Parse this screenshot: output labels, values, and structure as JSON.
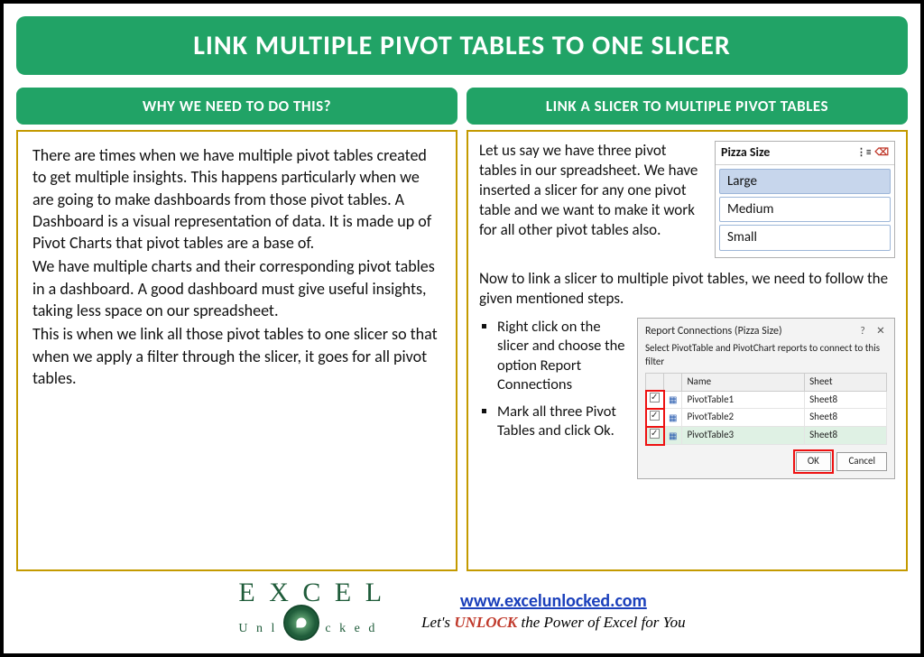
{
  "title": "LINK MULTIPLE PIVOT TABLES TO ONE SLICER",
  "left": {
    "header": "WHY WE NEED TO DO THIS?",
    "p1": "There are times when we have multiple pivot tables created to get multiple insights. This happens particularly when we are going to make dashboards from those pivot tables. A Dashboard is a visual representation of data. It is made up of Pivot Charts that pivot tables are a base of.",
    "p2": "We have multiple charts and their corresponding pivot tables in a dashboard. A good dashboard must give useful insights, taking less space on our spreadsheet.",
    "p3": "This is when we link all those pivot tables to one slicer so that when we apply a filter through the slicer, it goes for all pivot tables."
  },
  "right": {
    "header": "LINK A SLICER TO MULTIPLE PIVOT TABLES",
    "intro": "Let us say we have three pivot tables in our spreadsheet. We have inserted a slicer for any one pivot table and we want to make it work for all other pivot tables also.",
    "mid": "Now to link a slicer to multiple pivot tables, we need to follow the given mentioned steps.",
    "step1": "Right click on the slicer and choose the option Report Connections",
    "step2": "Mark all three Pivot Tables and click Ok.",
    "slicer": {
      "title": "Pizza Size",
      "items": [
        "Large",
        "Medium",
        "Small"
      ]
    },
    "dialog": {
      "title": "Report Connections (Pizza Size)",
      "sub": "Select PivotTable and PivotChart reports to connect to this filter",
      "cols": {
        "name": "Name",
        "sheet": "Sheet"
      },
      "rows": [
        {
          "name": "PivotTable1",
          "sheet": "Sheet8"
        },
        {
          "name": "PivotTable2",
          "sheet": "Sheet8"
        },
        {
          "name": "PivotTable3",
          "sheet": "Sheet8"
        }
      ],
      "ok": "OK",
      "cancel": "Cancel"
    }
  },
  "footer": {
    "logo_top": "E X C E L",
    "logo_sub": "U n l   c k e d",
    "url": "www.excelunlocked.com",
    "tag_pre": "Let's ",
    "tag_unlock": "UNLOCK",
    "tag_post": " the Power of Excel for You"
  }
}
